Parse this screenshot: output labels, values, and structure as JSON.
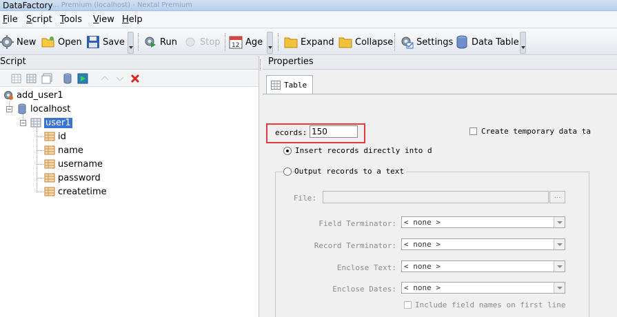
{
  "window": {
    "title": "DataFactory",
    "ghost_text": "... Premium (localhost) - Nextal Premium"
  },
  "menu": [
    "File",
    "Script",
    "Tools",
    "View",
    "Help"
  ],
  "menu_mnemonic": [
    "F",
    "S",
    "T",
    "V",
    "H"
  ],
  "menu_rest": [
    "ile",
    "cript",
    "ools",
    "iew",
    "elp"
  ],
  "toolbar": {
    "new": "New",
    "open": "Open",
    "save": "Save",
    "run": "Run",
    "stop": "Stop",
    "age": "Age",
    "expand": "Expand",
    "collapse": "Collapse",
    "settings": "Settings",
    "data_table": "Data Table"
  },
  "left_panel": {
    "header": "Script"
  },
  "tree": {
    "root": "add_user1",
    "server": "localhost",
    "table": "user1",
    "fields": [
      "id",
      "name",
      "username",
      "password",
      "createtime"
    ]
  },
  "right_panel": {
    "header": "Properties",
    "tab": "Table",
    "records_label": "ecords:",
    "records_value": "150",
    "temp_table_label": "Create temporary data ta",
    "insert_option": "Insert records directly into d",
    "output_option": "Output records to a text",
    "file_label": "File:",
    "browse": "...",
    "field_terminator_label": "Field Terminator:",
    "record_terminator_label": "Record Terminator:",
    "enclose_text_label": "Enclose Text:",
    "enclose_dates_label": "Enclose Dates:",
    "none_option": "< none >",
    "include_names_label": "Include field names on first line"
  },
  "colors": {
    "highlight_box": "#e03c3c",
    "selection": "#3b73d3"
  }
}
